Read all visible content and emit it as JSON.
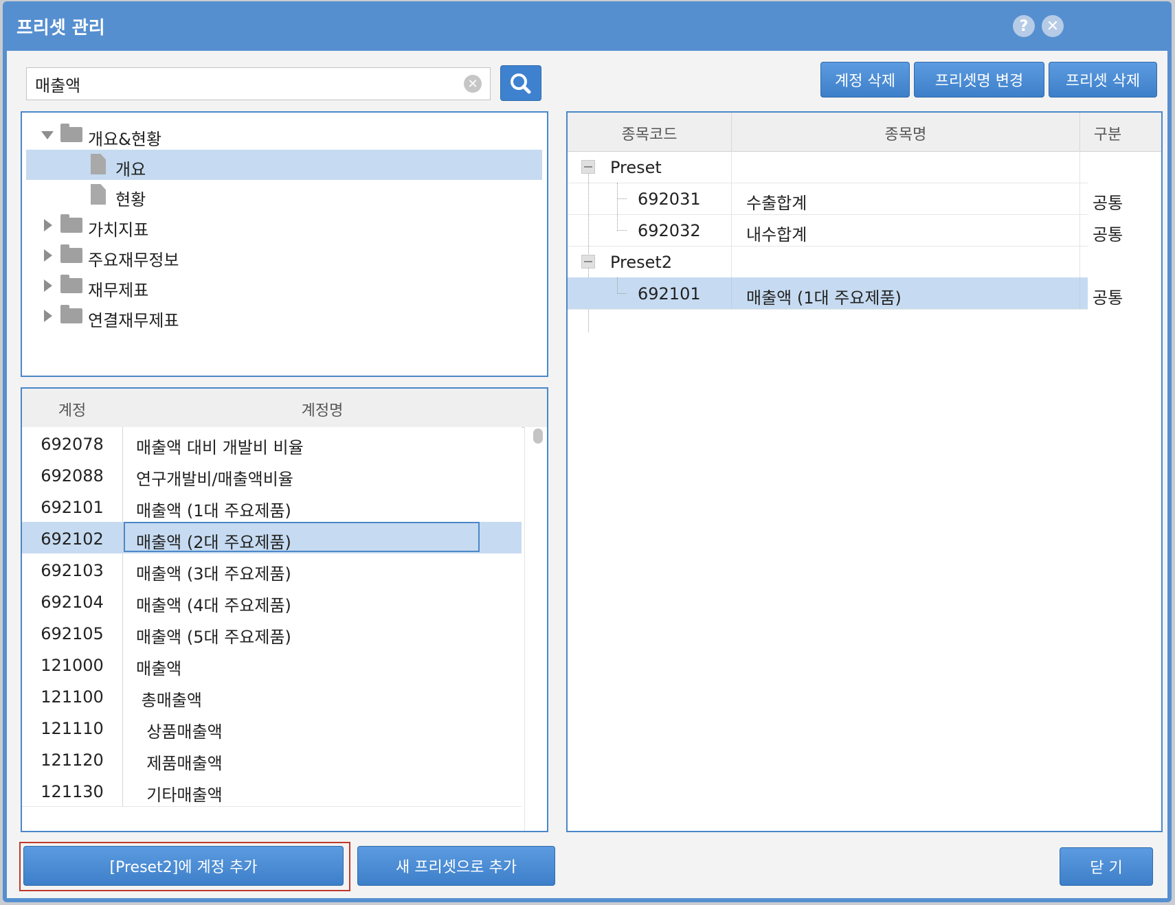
{
  "dialog": {
    "title": "프리셋 관리",
    "help_icon": "?",
    "close_icon": "✕"
  },
  "search": {
    "value": "매출액",
    "placeholder": "",
    "clear_icon": "✕"
  },
  "toolbar": {
    "delete_account": "계정 삭제",
    "rename_preset": "프리셋명 변경",
    "delete_preset": "프리셋 삭제"
  },
  "tree": {
    "items": [
      {
        "label": "개요&현황",
        "expanded": true
      },
      {
        "label": "개요",
        "selected": true
      },
      {
        "label": "현황"
      },
      {
        "label": "가치지표"
      },
      {
        "label": "주요재무정보"
      },
      {
        "label": "재무제표"
      },
      {
        "label": "연결재무제표"
      }
    ]
  },
  "accounts": {
    "headers": [
      "계정",
      "계정명"
    ],
    "rows": [
      {
        "code": "692078",
        "name": "매출액 대비 개발비 비율"
      },
      {
        "code": "692088",
        "name": "연구개발비/매출액비율"
      },
      {
        "code": "692101",
        "name": "매출액 (1대 주요제품)"
      },
      {
        "code": "692102",
        "name": "매출액 (2대 주요제품)",
        "selected": true
      },
      {
        "code": "692103",
        "name": "매출액 (3대 주요제품)"
      },
      {
        "code": "692104",
        "name": "매출액 (4대 주요제품)"
      },
      {
        "code": "692105",
        "name": "매출액 (5대 주요제품)"
      },
      {
        "code": "121000",
        "name": "매출액"
      },
      {
        "code": "121100",
        "name": " 총매출액"
      },
      {
        "code": "121110",
        "name": "  상품매출액"
      },
      {
        "code": "121120",
        "name": "  제품매출액"
      },
      {
        "code": "121130",
        "name": "  기타매출액"
      }
    ]
  },
  "presets": {
    "headers": [
      "종목코드",
      "종목명",
      "구분"
    ],
    "groups": [
      {
        "name": "Preset",
        "items": [
          {
            "code": "692031",
            "name": "수출합계",
            "type": "공통"
          },
          {
            "code": "692032",
            "name": "내수합계",
            "type": "공통"
          }
        ]
      },
      {
        "name": "Preset2",
        "items": [
          {
            "code": "692101",
            "name": "매출액 (1대 주요제품)",
            "type": "공통",
            "selected": true
          }
        ]
      }
    ]
  },
  "footer": {
    "add_to_preset": "[Preset2]에 계정 추가",
    "add_new_preset": "새 프리셋으로 추가",
    "close": "닫 기"
  },
  "colors": {
    "titlebar": "#558fd0",
    "button": "#3d7fc9",
    "selection": "#c6dbf1",
    "highlight_border": "#c0392b"
  }
}
